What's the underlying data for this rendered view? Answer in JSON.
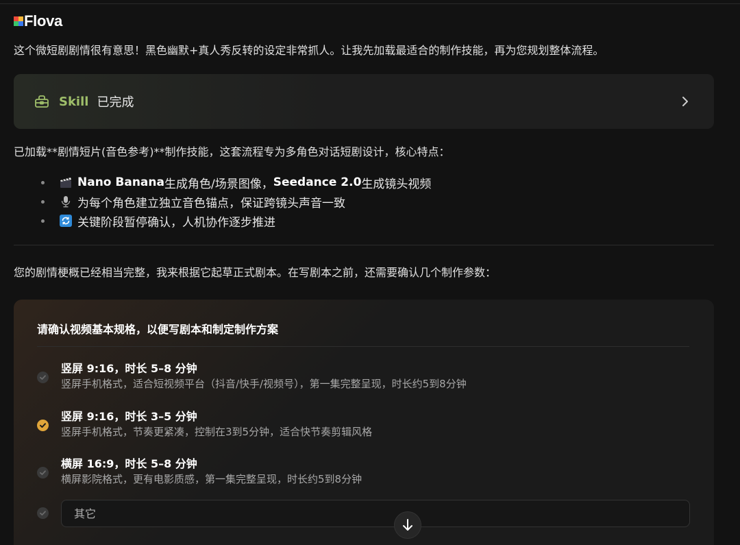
{
  "app": {
    "name": "Flova"
  },
  "intro_text": "这个微短剧剧情很有意思！黑色幽默+真人秀反转的设定非常抓人。让我先加载最适合的制作技能，再为您规划整体流程。",
  "skill_card": {
    "label": "Skill",
    "status": "已完成",
    "accent": "#9fbf6a"
  },
  "skill_desc": "已加载**剧情短片(音色参考)**制作技能，这套流程专为多角色对话短剧设计，核心特点：",
  "bullets": [
    {
      "icon": "clapper-board-icon",
      "b1": "Nano Banana",
      "t1": " 生成角色/场景图像，",
      "b2": "Seedance 2.0",
      "t2": " 生成镜头视频"
    },
    {
      "icon": "microphone-icon",
      "t1": "为每个角色建立独立音色锚点，保证跨镜头声音一致"
    },
    {
      "icon": "cycle-arrows-icon",
      "t1": "关键阶段暂停确认，人机协作逐步推进"
    }
  ],
  "followup_text": "您的剧情梗概已经相当完整，我来根据它起草正式剧本。在写剧本之前，还需要确认几个制作参数：",
  "options_card": {
    "title": "请确认视频基本规格，以便写剧本和制定制作方案",
    "selected_color": "#e0a53a",
    "options": [
      {
        "title": "竖屏 9:16，时长 5–8 分钟",
        "desc": "竖屏手机格式，适合短视频平台（抖音/快手/视频号），第一集完整呈现，时长约5到8分钟",
        "selected": false
      },
      {
        "title": "竖屏 9:16，时长 3–5 分钟",
        "desc": "竖屏手机格式，节奏更紧凑，控制在3到5分钟，适合快节奏剪辑风格",
        "selected": true
      },
      {
        "title": "横屏 16:9，时长 5–8 分钟",
        "desc": "横屏影院格式，更有电影质感，第一集完整呈现，时长约5到8分钟",
        "selected": false
      }
    ],
    "other_placeholder": "其它"
  }
}
